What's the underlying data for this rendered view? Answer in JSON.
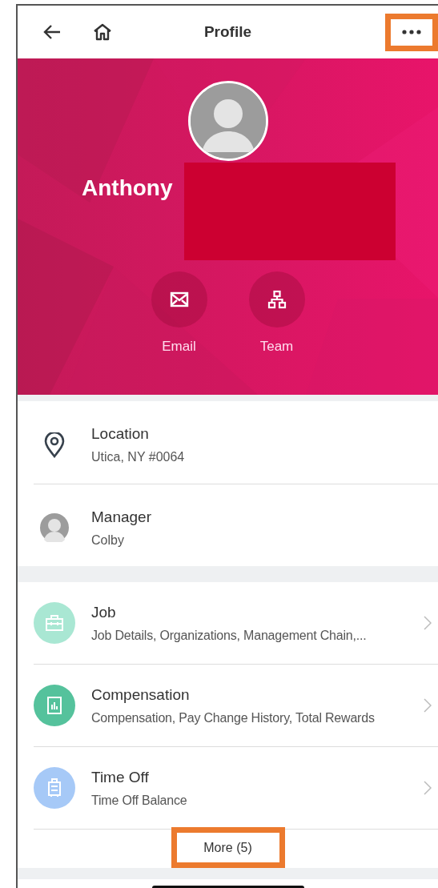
{
  "header": {
    "title": "Profile",
    "more_highlighted": true
  },
  "hero": {
    "first_name": "Anthony",
    "surname_redacted": true
  },
  "actions": [
    {
      "label": "Email",
      "kind": "mail"
    },
    {
      "label": "Team",
      "kind": "org"
    }
  ],
  "info_rows": [
    {
      "kind": "location",
      "title": "Location",
      "value": "Utica, NY #0064"
    },
    {
      "kind": "manager",
      "title": "Manager",
      "value": "Colby"
    }
  ],
  "sections": [
    {
      "kind": "job",
      "color": "#a9e7d3",
      "title": "Job",
      "subtitle": "Job Details, Organizations, Management Chain,..."
    },
    {
      "kind": "pay",
      "color": "#55c29c",
      "title": "Compensation",
      "subtitle": "Compensation, Pay Change History, Total Rewards"
    },
    {
      "kind": "leave",
      "color": "#a6c9f7",
      "title": "Time Off",
      "subtitle": "Time Off Balance"
    }
  ],
  "more_button": {
    "label": "More (5)",
    "highlighted": true
  }
}
